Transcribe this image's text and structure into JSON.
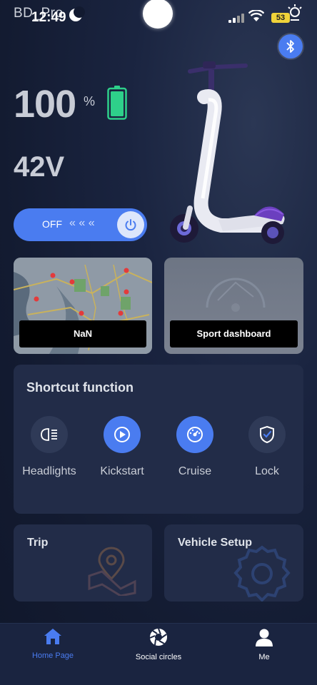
{
  "status_bar": {
    "carrier": "BD_Pro",
    "time": "12:49",
    "battery_level": "53"
  },
  "dashboard": {
    "battery_percent": "100",
    "percent_sign": "%",
    "voltage": "42V",
    "power_toggle": {
      "label": "OFF",
      "chevrons": "« « «"
    }
  },
  "cards": {
    "map_label": "NaN",
    "sport_label": "Sport dashboard"
  },
  "shortcut": {
    "title": "Shortcut function",
    "items": [
      {
        "label": "Headlights",
        "icon": "headlight-icon",
        "active": false
      },
      {
        "label": "Kickstart",
        "icon": "kickstart-icon",
        "active": true
      },
      {
        "label": "Cruise",
        "icon": "cruise-icon",
        "active": true
      },
      {
        "label": "Lock",
        "icon": "lock-shield-icon",
        "active": false
      }
    ]
  },
  "bottom_cards": {
    "trip": "Trip",
    "setup": "Vehicle Setup"
  },
  "tabs": [
    {
      "label": "Home Page",
      "icon": "home-icon",
      "active": true
    },
    {
      "label": "Social circles",
      "icon": "aperture-icon",
      "active": false
    },
    {
      "label": "Me",
      "icon": "user-icon",
      "active": false
    }
  ],
  "colors": {
    "accent": "#4a7cf0",
    "battery": "#2ed08a",
    "background": "#131b31",
    "panel": "#222c48"
  }
}
